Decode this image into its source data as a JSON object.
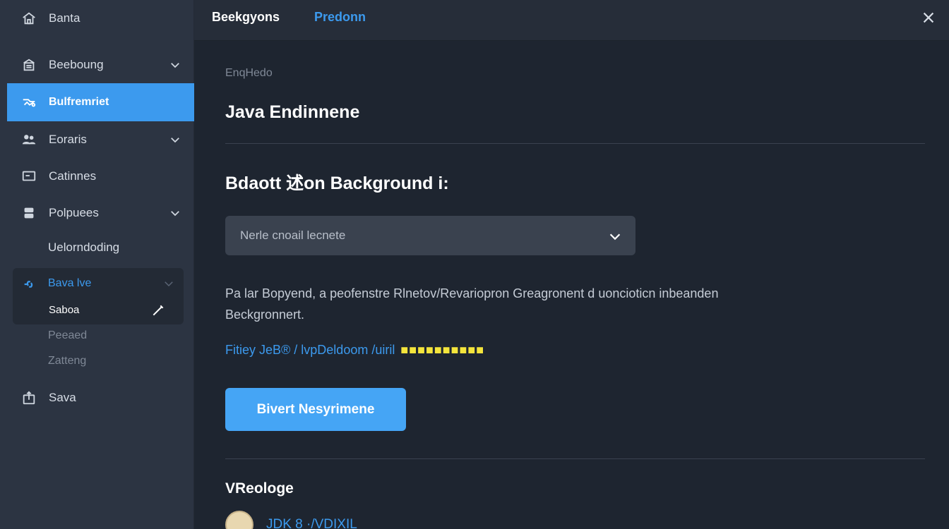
{
  "sidebar": {
    "items": [
      {
        "label": "Banta",
        "icon": "home-icon"
      },
      {
        "label": "Beeboung",
        "icon": "building-icon",
        "chevron": true
      },
      {
        "label": "Bulfremriet",
        "icon": "tools-icon",
        "active": true
      },
      {
        "label": "Eoraris",
        "icon": "people-icon",
        "chevron": true
      },
      {
        "label": "Catinnes",
        "icon": "monitor-icon"
      },
      {
        "label": "Polpuees",
        "icon": "database-icon",
        "chevron": true
      },
      {
        "label": "Uelorndoding"
      }
    ],
    "group": {
      "title": "Bava lve",
      "sub": "Saboa",
      "icon": "link-icon"
    },
    "muted_items": [
      "Peeaed",
      "Zatteng"
    ],
    "save": {
      "label": "Sava",
      "icon": "share-icon"
    }
  },
  "topbar": {
    "tabs": [
      "Beekgyons",
      "Predonn"
    ],
    "close": "×"
  },
  "main": {
    "breadcrumb": "EnqHedo",
    "title": "Java Endinnene",
    "section_title": "Bdaott 述on Background i:",
    "select": {
      "value": "Nerle cnoail lecnete"
    },
    "description": "Pa lar Bopyend, a peofenstre Rlnetov/Revariopron Greagronent d uoncioticn inbeanden Beckgronnert.",
    "link": {
      "text": "Fitiey JeB® / lvpDeldoom /uiril",
      "highlight": "■■■■■■■■■■"
    },
    "primary_button": "Bivert Nesyrimene",
    "sub_heading": "VReologe",
    "jdk_label": "JDK 8 ·/VDIXIL"
  },
  "colors": {
    "accent": "#3c9aee",
    "sidebar_bg": "#2c3442",
    "main_bg": "#1e2530",
    "highlight": "#f4e53c"
  }
}
